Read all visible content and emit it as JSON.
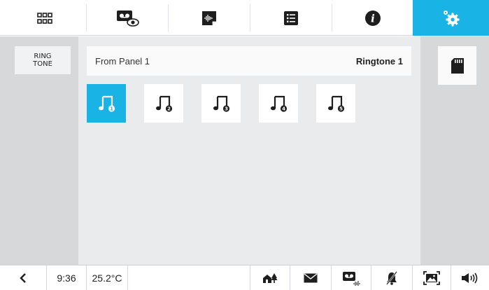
{
  "top_tabs": [
    {
      "name": "apps-grid",
      "icon": "grid-icon"
    },
    {
      "name": "video-messages",
      "icon": "video-message-eye-icon"
    },
    {
      "name": "audio-memo",
      "icon": "audio-note-icon"
    },
    {
      "name": "list",
      "icon": "list-icon"
    },
    {
      "name": "info",
      "icon": "info-icon"
    },
    {
      "name": "settings",
      "icon": "settings-gears-icon",
      "active": true
    }
  ],
  "left_panel": {
    "ring_tone_label": "RING\nTONE"
  },
  "source": {
    "label": "From Panel 1",
    "value": "Ringtone 1"
  },
  "tones": [
    {
      "icon": "music-note-1-icon",
      "selected": true
    },
    {
      "icon": "music-note-2-icon",
      "selected": false
    },
    {
      "icon": "music-note-3-icon",
      "selected": false
    },
    {
      "icon": "music-note-4-icon",
      "selected": false
    },
    {
      "icon": "music-note-5-icon",
      "selected": false
    }
  ],
  "right_panel": {
    "icon": "sd-card-icon"
  },
  "status": {
    "time": "9:36",
    "temperature": "25.2°C"
  },
  "colors": {
    "accent": "#1ab3e5",
    "panel": "#d6d8da",
    "main": "#eaebec"
  }
}
